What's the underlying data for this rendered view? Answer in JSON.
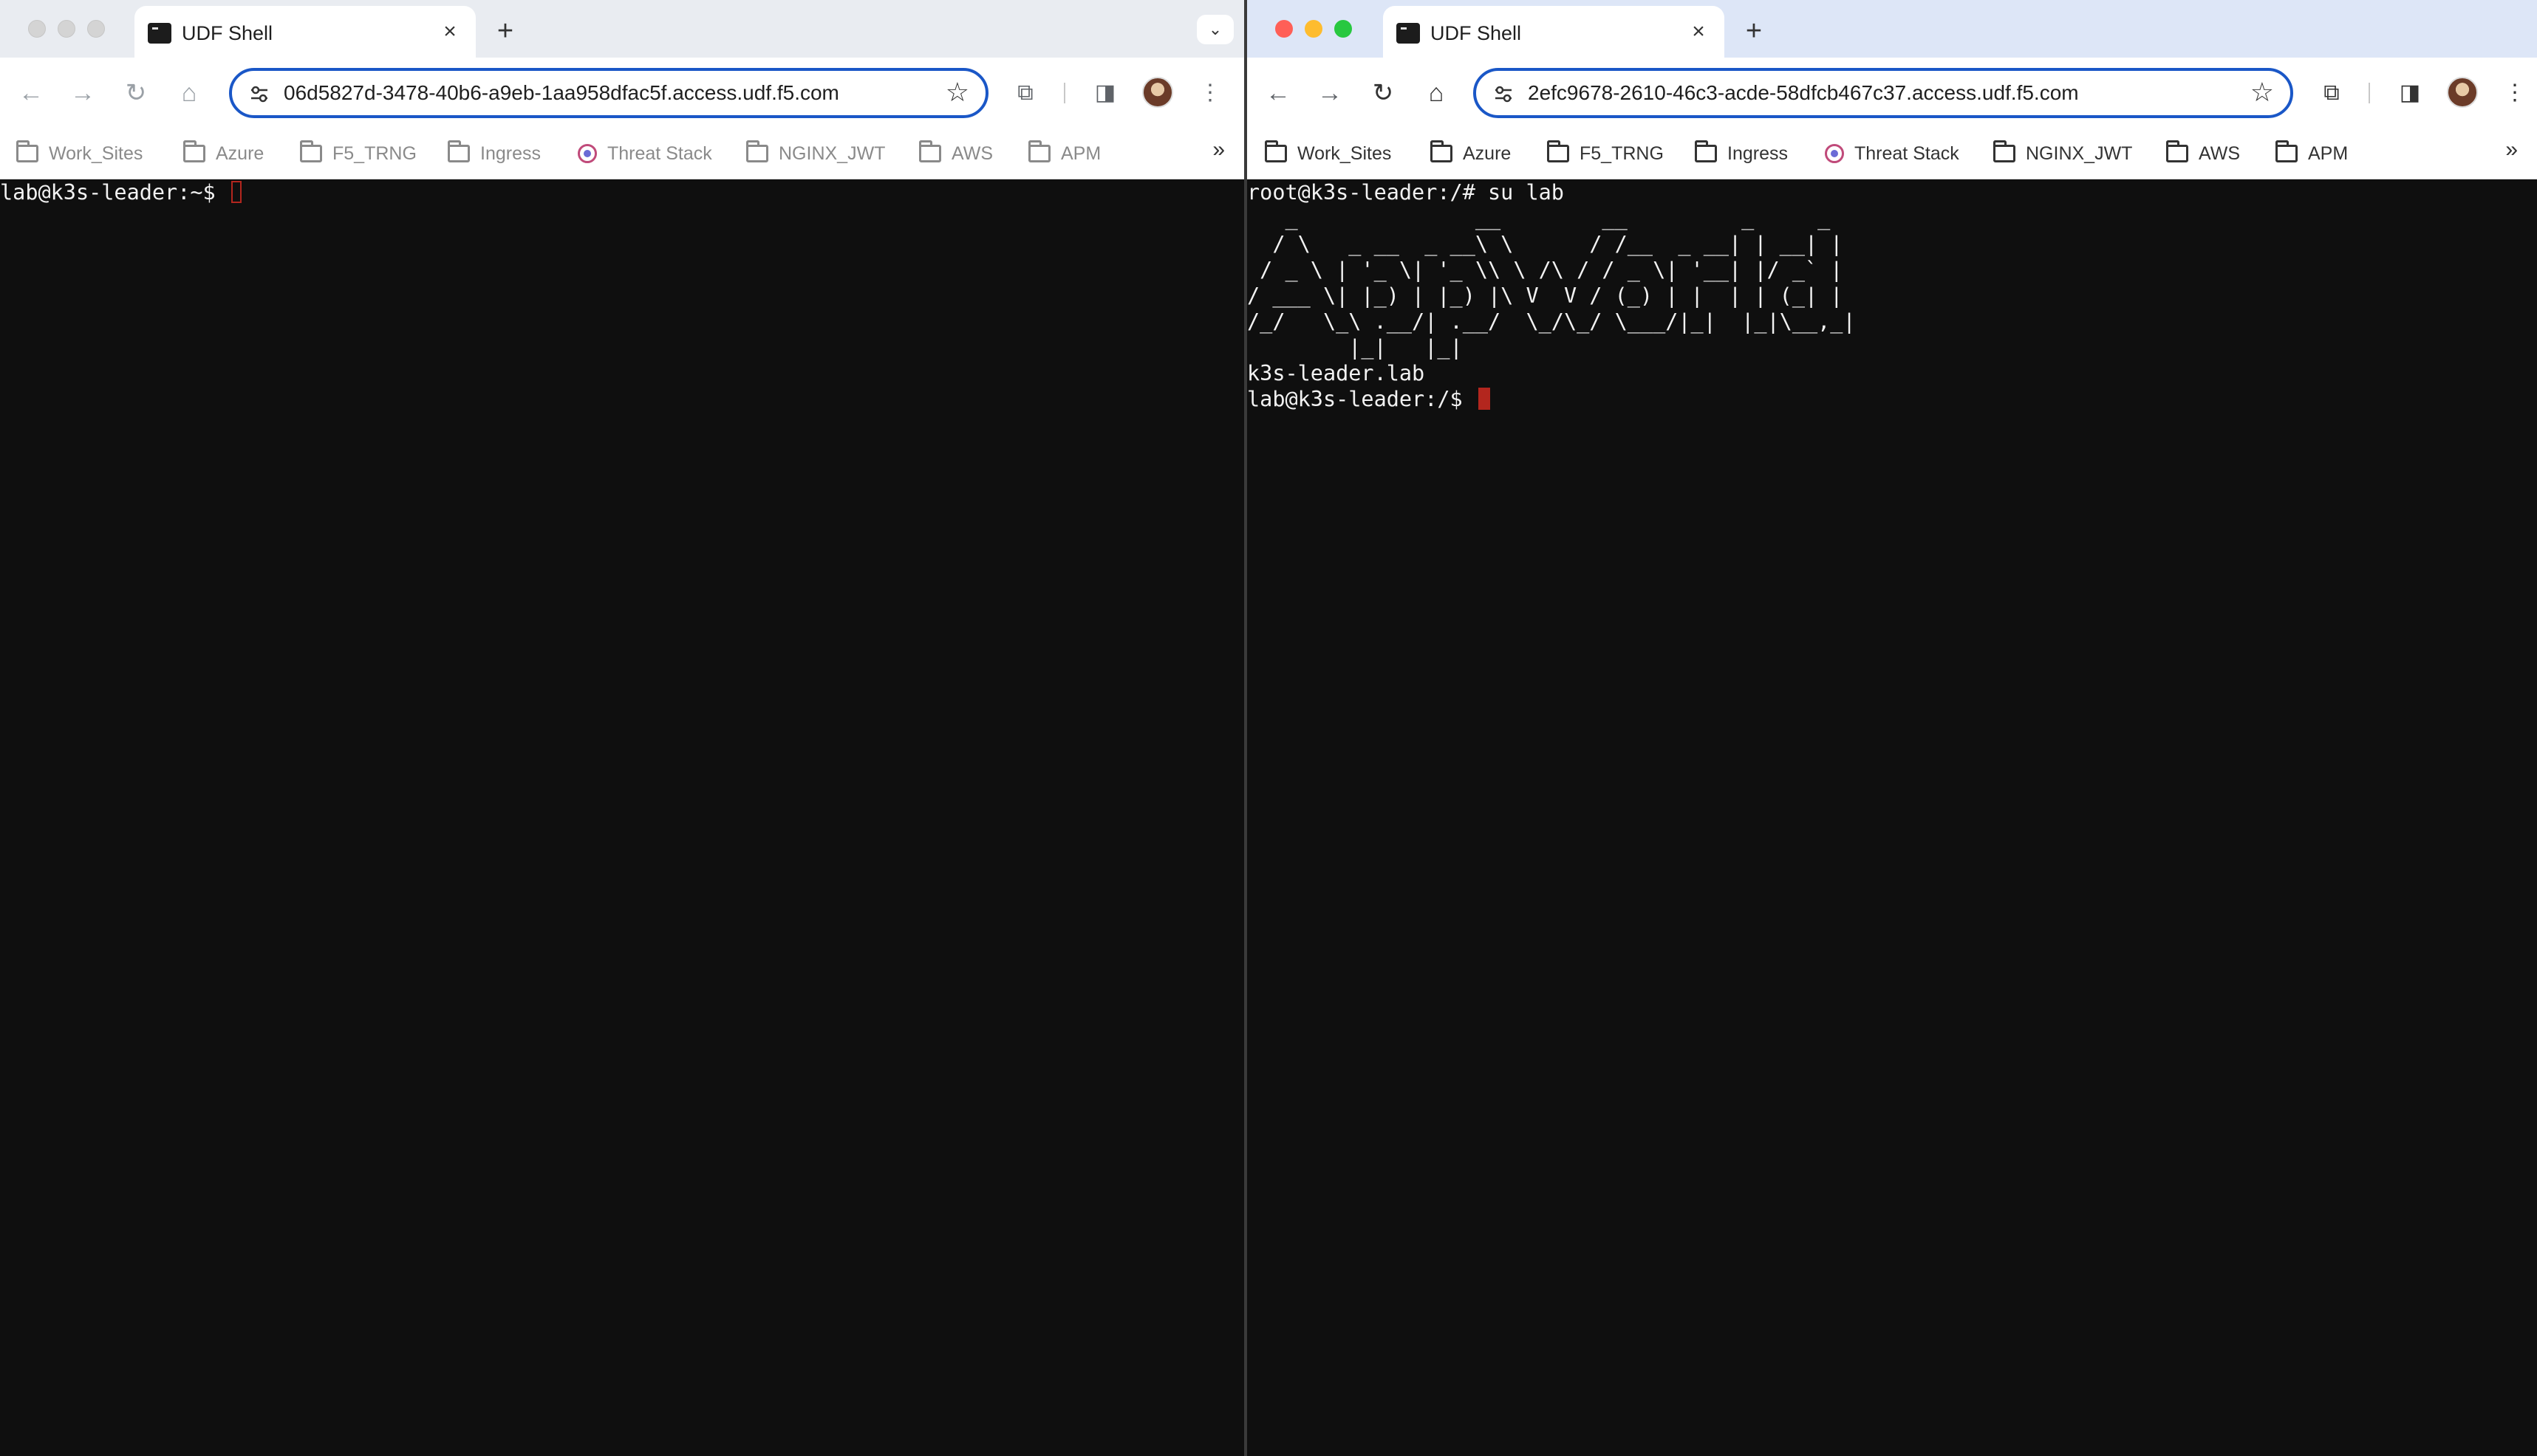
{
  "left": {
    "tab_title": "UDF Shell",
    "url": "06d5827d-3478-40b6-a9eb-1aa958dfac5f.access.udf.f5.com",
    "terminal_prompt": "lab@k3s-leader:~$ "
  },
  "right": {
    "tab_title": "UDF Shell",
    "url": "2efc9678-2610-46c3-acde-58dfcb467c37.access.udf.f5.com",
    "terminal": {
      "command_line": "root@k3s-leader:/# su lab",
      "ascii_banner": "   _              __        __         _     _ \n  / \\   _ __  _ __\\ \\      / /__  _ __| | __| |\n / _ \\ | '_ \\| '_ \\\\ \\ /\\ / / _ \\| '__| |/ _` |\n/ ___ \\| |_) | |_) |\\ V  V / (_) | |  | | (_| |\n/_/   \\_\\ .__/| .__/  \\_/\\_/ \\___/|_|  |_|\\__,_|\n        |_|   |_|",
      "hostname": "k3s-leader.lab",
      "prompt": "lab@k3s-leader:/$ "
    }
  },
  "bookmarks": [
    "Work_Sites",
    "Azure",
    "F5_TRNG",
    "Ingress",
    "Threat Stack",
    "NGINX_JWT",
    "AWS",
    "APM"
  ],
  "icons": {
    "back": "arrow-left-icon",
    "forward": "arrow-right-icon",
    "reload": "reload-icon",
    "home": "home-icon",
    "star": "star-icon",
    "extensions": "puzzle-icon",
    "side_panel": "side-panel-icon",
    "menu": "kebab-menu-icon"
  },
  "colors": {
    "omnibox_border": "#1a57c7",
    "cursor": "#b3261e",
    "terminal_bg": "#0f0f0f",
    "terminal_fg": "#f2f2f2"
  }
}
